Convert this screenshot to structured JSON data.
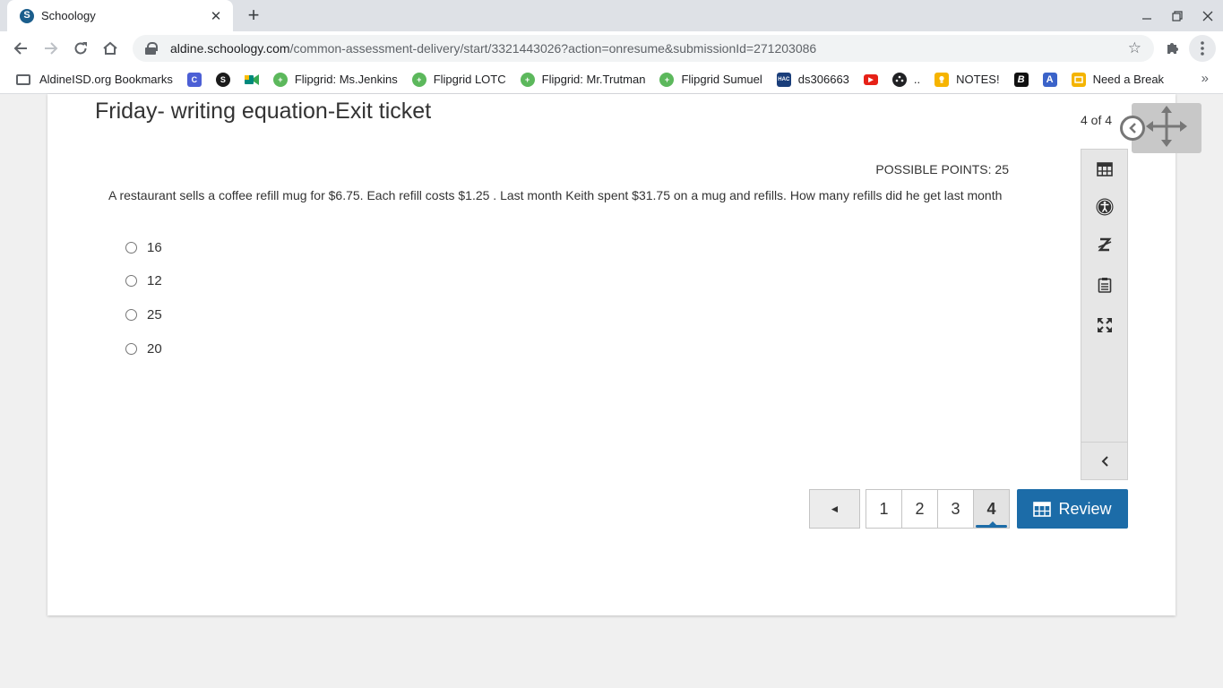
{
  "browser": {
    "tab": {
      "title": "Schoology",
      "favicon": "S"
    },
    "url": {
      "host": "aldine.schoology.com",
      "path": "/common-assessment-delivery/start/3321443026?action=onresume&submissionId=271203086"
    },
    "bookmarks": [
      {
        "label": "AldineISD.org Bookmarks",
        "icon": "folder-icon"
      },
      {
        "label": "",
        "icon": "c-icon",
        "glyph": "C",
        "color": "#4c5fd5"
      },
      {
        "label": "",
        "icon": "schoology-icon",
        "glyph": "S",
        "color": "#1b1b1b"
      },
      {
        "label": "",
        "icon": "meet-icon",
        "glyph": "",
        "color": "#00897b"
      },
      {
        "label": "Flipgrid: Ms.Jenkins",
        "icon": "flipgrid-icon",
        "color": "#5cb85c"
      },
      {
        "label": "Flipgrid LOTC",
        "icon": "flipgrid-icon",
        "color": "#5cb85c"
      },
      {
        "label": "Flipgrid: Mr.Trutman",
        "icon": "flipgrid-icon",
        "color": "#5cb85c"
      },
      {
        "label": "Flipgrid Sumuel",
        "icon": "flipgrid-icon",
        "color": "#5cb85c"
      },
      {
        "label": "ds306663",
        "icon": "hac-icon",
        "glyph": "HAC",
        "color": "#1a3e7a"
      },
      {
        "label": "",
        "icon": "youtube-icon",
        "glyph": "▶",
        "color": "#e62117"
      },
      {
        "label": "..",
        "icon": "film-icon",
        "glyph": "",
        "color": "#202124"
      },
      {
        "label": "NOTES!",
        "icon": "keep-icon",
        "glyph": "",
        "color": "#f6b400"
      },
      {
        "label": "",
        "icon": "b-icon",
        "glyph": "B",
        "color": "#111111"
      },
      {
        "label": "",
        "icon": "a-icon",
        "glyph": "A",
        "color": "#3b63c9"
      },
      {
        "label": "Need a Break",
        "icon": "slides-icon",
        "glyph": "",
        "color": "#f4b400"
      }
    ]
  },
  "assessment": {
    "title": "Friday- writing equation-Exit ticket",
    "counter": "4 of 4",
    "points_label": "POSSIBLE POINTS: 25",
    "question": "A restaurant sells a coffee refill mug for $6.75. Each refill costs $1.25 . Last month Keith spent $31.75 on a mug and refills. How many refills did he get last month",
    "choices": [
      "16",
      "12",
      "25",
      "20"
    ],
    "pages": [
      "1",
      "2",
      "3",
      "4"
    ],
    "current_page": "4",
    "prev_glyph": "◄",
    "review_label": "Review"
  },
  "colors": {
    "accent": "#1c6ca8",
    "rail": "#e6e6e6"
  }
}
